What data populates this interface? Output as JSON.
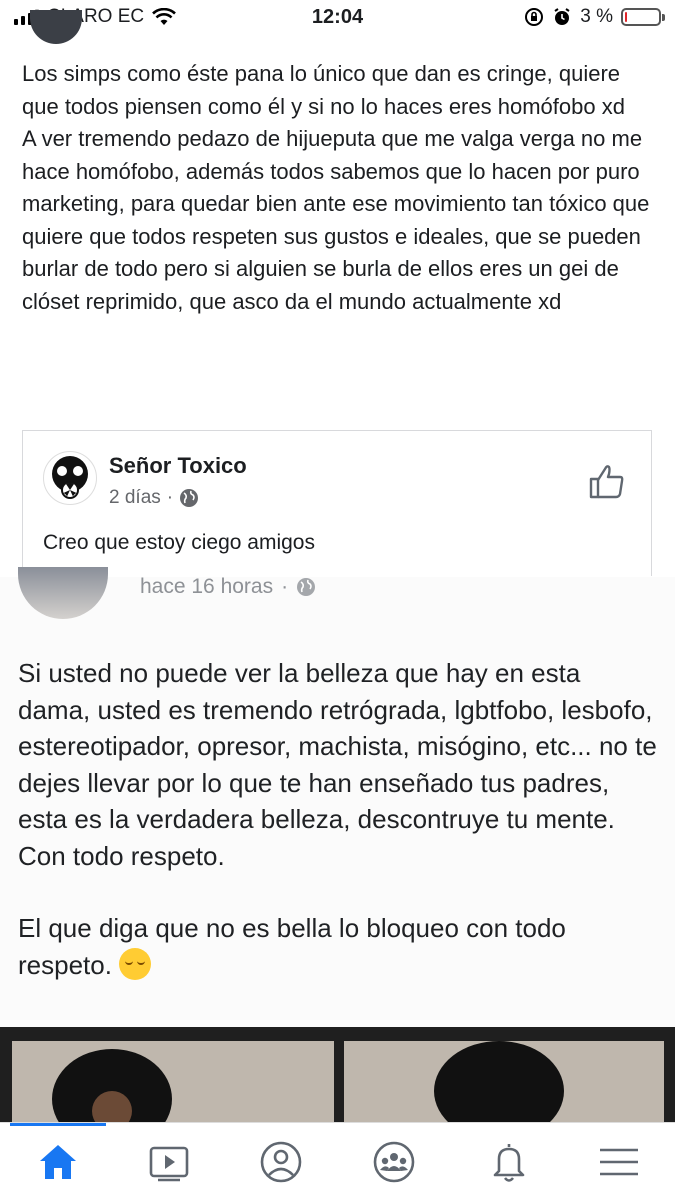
{
  "status_bar": {
    "carrier": "CLARO EC",
    "time": "12:04",
    "battery_percent": "3 %",
    "battery_level": 0.03
  },
  "comment": {
    "paragraph1": "Los simps como éste pana lo único que dan es cringe, quiere que todos piensen como él y si no lo haces eres homófobo xd",
    "paragraph2": "A ver tremendo pedazo de hijueputa que me valga verga no me hace homófobo, además todos sabemos que lo hacen por puro marketing, para quedar bien ante ese movimiento tan tóxico que quiere que todos respeten sus gustos e ideales, que se pueden burlar de todo pero si alguien se burla de ellos eres un gei de clóset reprimido, que asco da el mundo actualmente xd"
  },
  "shared_post": {
    "author": "Señor Toxico",
    "time": "2 días",
    "separator": "·",
    "text": "Creo que estoy ciego amigos"
  },
  "embedded_post": {
    "time": "hace 16 horas",
    "separator": "·",
    "paragraph1": "Si usted no puede ver la belleza que hay en esta dama, usted es tremendo retrógrada, lgbtfobo, lesbofo, estereotipador, opresor, machista, misógino, etc... no te dejes llevar por lo que te han enseñado tus padres, esta es la verdadera belleza, descontruye tu mente. Con todo respeto.",
    "paragraph2": "El que diga que no es bella lo bloqueo con todo respeto."
  },
  "bottom_nav": {
    "items": [
      "home-icon",
      "video-icon",
      "profile-icon",
      "groups-icon",
      "notifications-icon",
      "menu-icon"
    ],
    "active": "home-icon",
    "accent_color": "#1877f2"
  }
}
